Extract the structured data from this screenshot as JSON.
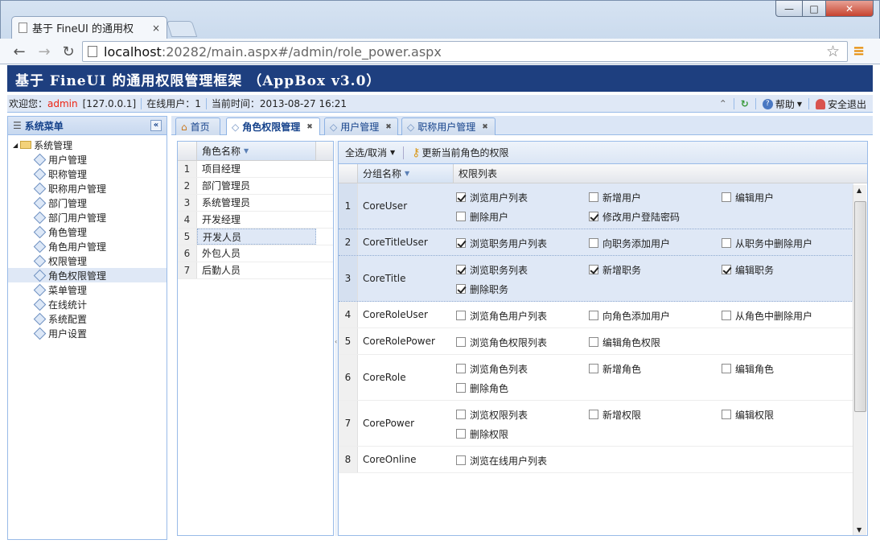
{
  "browser": {
    "tab_title": "基于 FineUI 的通用权",
    "tab_close": "×",
    "url_host": "localhost",
    "url_rest": ":20282/main.aspx#/admin/role_power.aspx",
    "win_min": "—",
    "win_max": "□",
    "win_close": "✕"
  },
  "app": {
    "title": "基于 FineUI 的通用权限管理框架 （AppBox v3.0）"
  },
  "infobar": {
    "welcome_label": "欢迎您：",
    "user": "admin",
    "ip": "[127.0.0.1]",
    "online_label": "在线用户：",
    "online_count": "1",
    "time_label": "当前时间：",
    "time_value": "2013-08-27 16:21",
    "help_label": "帮助",
    "logout_label": "安全退出"
  },
  "sidebar": {
    "title": "系统菜单",
    "collapse": "«",
    "root": "系统管理",
    "items": [
      "用户管理",
      "职称管理",
      "职称用户管理",
      "部门管理",
      "部门用户管理",
      "角色管理",
      "角色用户管理",
      "权限管理",
      "角色权限管理",
      "菜单管理",
      "在线统计",
      "系统配置",
      "用户设置"
    ],
    "selected_index": 8
  },
  "tabs": [
    {
      "label": "首页",
      "closable": false
    },
    {
      "label": "角色权限管理",
      "closable": true,
      "active": true
    },
    {
      "label": "用户管理",
      "closable": true
    },
    {
      "label": "职称用户管理",
      "closable": true
    }
  ],
  "roles_grid": {
    "header": "角色名称",
    "rows": [
      "项目经理",
      "部门管理员",
      "系统管理员",
      "开发经理",
      "开发人员",
      "外包人员",
      "后勤人员"
    ],
    "selected_index": 4
  },
  "power_grid": {
    "toolbar": {
      "select_all": "全选/取消",
      "update": "更新当前角色的权限"
    },
    "header_group": "分组名称",
    "header_list": "权限列表",
    "rows": [
      {
        "num": "1",
        "group": "CoreUser",
        "selected": true,
        "perms": [
          {
            "label": "浏览用户列表",
            "checked": true
          },
          {
            "label": "新增用户",
            "checked": false
          },
          {
            "label": "编辑用户",
            "checked": false
          },
          {
            "label": "删除用户",
            "checked": false
          },
          {
            "label": "修改用户登陆密码",
            "checked": true
          }
        ]
      },
      {
        "num": "2",
        "group": "CoreTitleUser",
        "selected": true,
        "perms": [
          {
            "label": "浏览职务用户列表",
            "checked": true
          },
          {
            "label": "向职务添加用户",
            "checked": false
          },
          {
            "label": "从职务中删除用户",
            "checked": false
          }
        ]
      },
      {
        "num": "3",
        "group": "CoreTitle",
        "selected": true,
        "perms": [
          {
            "label": "浏览职务列表",
            "checked": true
          },
          {
            "label": "新增职务",
            "checked": true
          },
          {
            "label": "编辑职务",
            "checked": true
          },
          {
            "label": "删除职务",
            "checked": true
          }
        ]
      },
      {
        "num": "4",
        "group": "CoreRoleUser",
        "selected": false,
        "perms": [
          {
            "label": "浏览角色用户列表",
            "checked": false
          },
          {
            "label": "向角色添加用户",
            "checked": false
          },
          {
            "label": "从角色中删除用户",
            "checked": false
          }
        ]
      },
      {
        "num": "5",
        "group": "CoreRolePower",
        "selected": false,
        "perms": [
          {
            "label": "浏览角色权限列表",
            "checked": false
          },
          {
            "label": "编辑角色权限",
            "checked": false
          }
        ]
      },
      {
        "num": "6",
        "group": "CoreRole",
        "selected": false,
        "perms": [
          {
            "label": "浏览角色列表",
            "checked": false
          },
          {
            "label": "新增角色",
            "checked": false
          },
          {
            "label": "编辑角色",
            "checked": false
          },
          {
            "label": "删除角色",
            "checked": false
          }
        ]
      },
      {
        "num": "7",
        "group": "CorePower",
        "selected": false,
        "perms": [
          {
            "label": "浏览权限列表",
            "checked": false
          },
          {
            "label": "新增权限",
            "checked": false
          },
          {
            "label": "编辑权限",
            "checked": false
          },
          {
            "label": "删除权限",
            "checked": false
          }
        ]
      },
      {
        "num": "8",
        "group": "CoreOnline",
        "selected": false,
        "perms": [
          {
            "label": "浏览在线用户列表",
            "checked": false
          }
        ]
      }
    ]
  }
}
